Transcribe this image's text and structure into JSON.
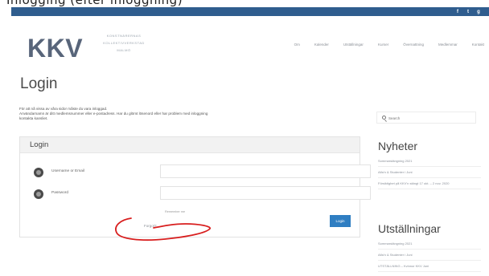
{
  "caption": {
    "text": "Inlogging (efter inloggning)"
  },
  "social": {
    "icons": [
      "f",
      "t",
      "g"
    ]
  },
  "header": {
    "logo": "KKV",
    "logo_sub": [
      "KONSTNÄRERNAS",
      "KOLLEKTIVVERKSTAD",
      "MALMÖ"
    ],
    "nav": [
      "Om",
      "Kalender",
      "Utställningar",
      "Kurser",
      "Övernattning",
      "Medlemmar",
      "Kontakt"
    ]
  },
  "main": {
    "title": "Login",
    "intro": [
      "För att nå vissa av våra sidor måste du vara inloggad.",
      "Användarnamn är ditt medlemsnummer eller e-postadress. Har du glömt lösenord eller har problem med inloggning",
      "kontakta kansliet."
    ]
  },
  "login": {
    "heading": "Login",
    "username_label": "Username or Email",
    "password_label": "Password",
    "username_value": "",
    "password_value": "",
    "remember_label": "Remember me",
    "forgot_label": "Forgot?",
    "submit_label": "Login"
  },
  "sidebar": {
    "search_placeholder": "Search",
    "news_title": "Nyheter",
    "news_items": [
      "Sommarstängning 2021",
      "Alfa'n & Studenter i Juni",
      "Försiktighet på KKV'n stängt 17 okt. – 2 nov. 2020"
    ],
    "exhib_title": "Utställningar",
    "exhib_items": [
      "Sommarstängning 2021",
      "Alfa'n & Studenter i Juni",
      "UTSTÄLLNING – Kvinnor KKV Juni"
    ]
  },
  "colors": {
    "social_bar": "#2f5d8e",
    "logo": "#58657a",
    "button": "#2f7ec2",
    "annotation": "#d81e1e"
  }
}
